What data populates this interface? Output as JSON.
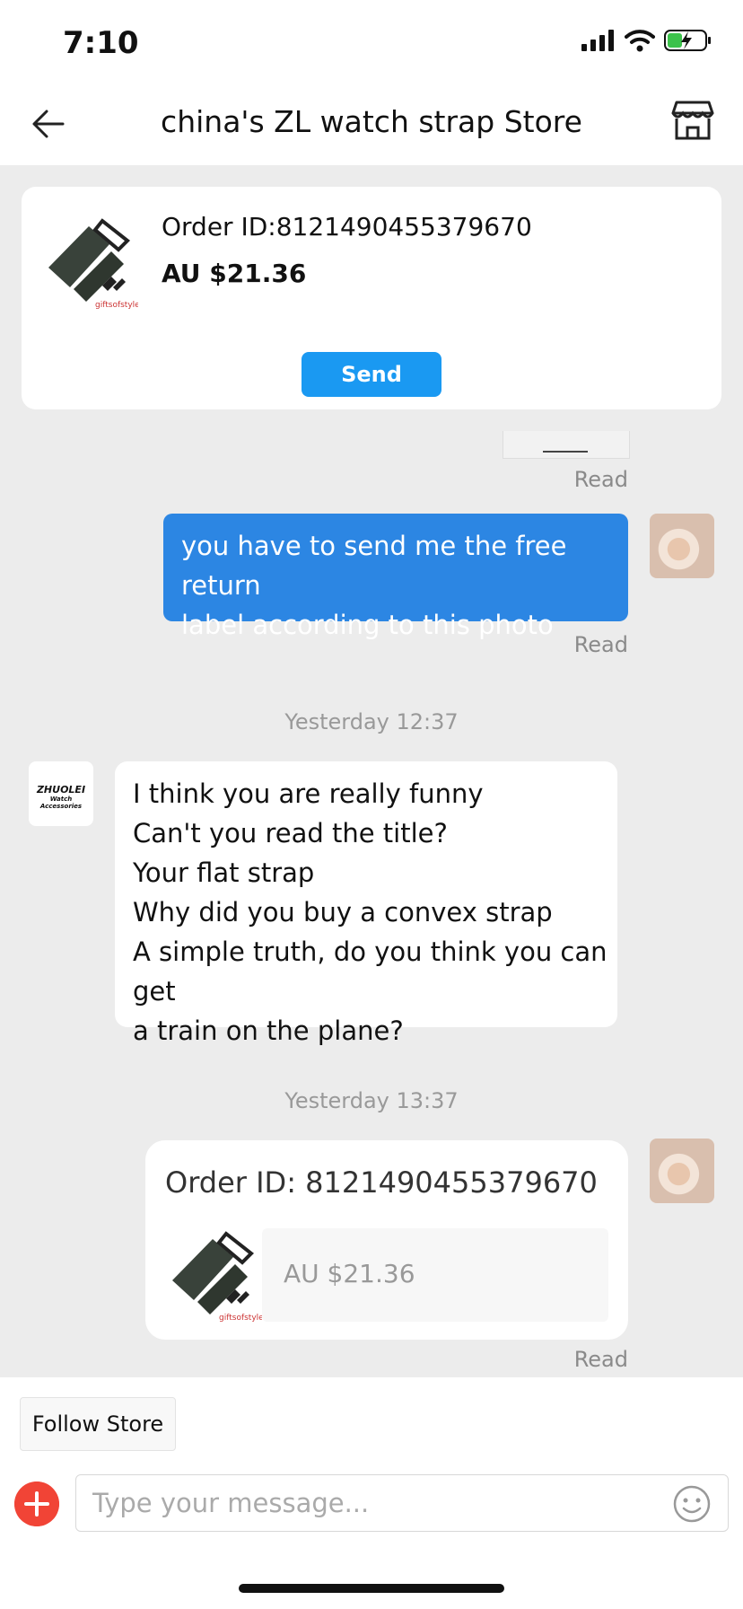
{
  "status_bar": {
    "time": "7:10"
  },
  "header": {
    "title": "china's ZL watch strap Store"
  },
  "order_card": {
    "order_id": "Order ID:8121490455379670",
    "price": "AU $21.36",
    "send_label": "Send"
  },
  "messages": {
    "read_1": "Read",
    "user_text": [
      "you have to send me the free return",
      "label according to this photo"
    ],
    "read_2": "Read",
    "timestamp_1": "Yesterday 12:37",
    "store_logo_text": [
      "ZHUOLEI",
      "Watch Accessories"
    ],
    "store_text": [
      "I think you are really funny",
      "Can't you read the title?",
      "Your flat strap",
      "Why did you buy a convex strap",
      "A simple truth, do you think you can get",
      "a train on the plane?"
    ],
    "timestamp_2": "Yesterday 13:37",
    "shared_order": {
      "title": "Order ID: 8121490455379670",
      "price": "AU $21.36"
    },
    "read_3": "Read"
  },
  "footer": {
    "follow_label": "Follow Store",
    "input_placeholder": "Type your message..."
  },
  "colors": {
    "accent_blue": "#2c86e3",
    "send_blue": "#1a99f2",
    "plus_red": "#f14436"
  }
}
